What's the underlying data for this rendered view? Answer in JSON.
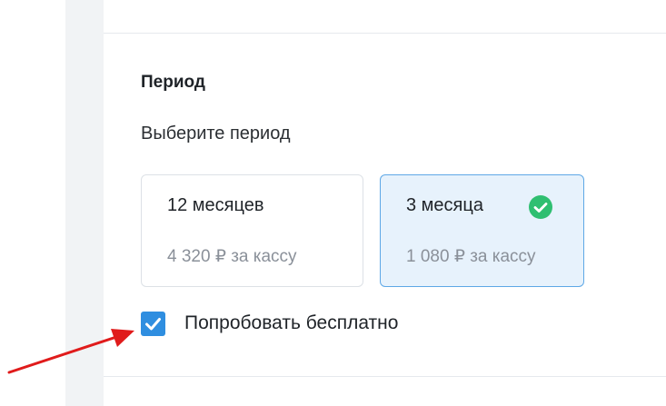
{
  "period": {
    "title": "Период",
    "subtitle": "Выберите период"
  },
  "options": [
    {
      "label": "12 месяцев",
      "price": "4 320 ₽ за кассу",
      "selected": false
    },
    {
      "label": "3 месяца",
      "price": "1 080 ₽ за кассу",
      "selected": true
    }
  ],
  "trial": {
    "label": "Попробовать бесплатно",
    "checked": true
  },
  "colors": {
    "accent": "#2f8ee0",
    "selected_bg": "#e7f2fc",
    "selected_border": "#5ea8e6",
    "success": "#2fbf71",
    "annotation": "#e01b1b"
  },
  "icons": {
    "selected_mark": "check-circle-icon",
    "checkbox_mark": "checkmark-icon",
    "annotation": "red-arrow-icon"
  }
}
